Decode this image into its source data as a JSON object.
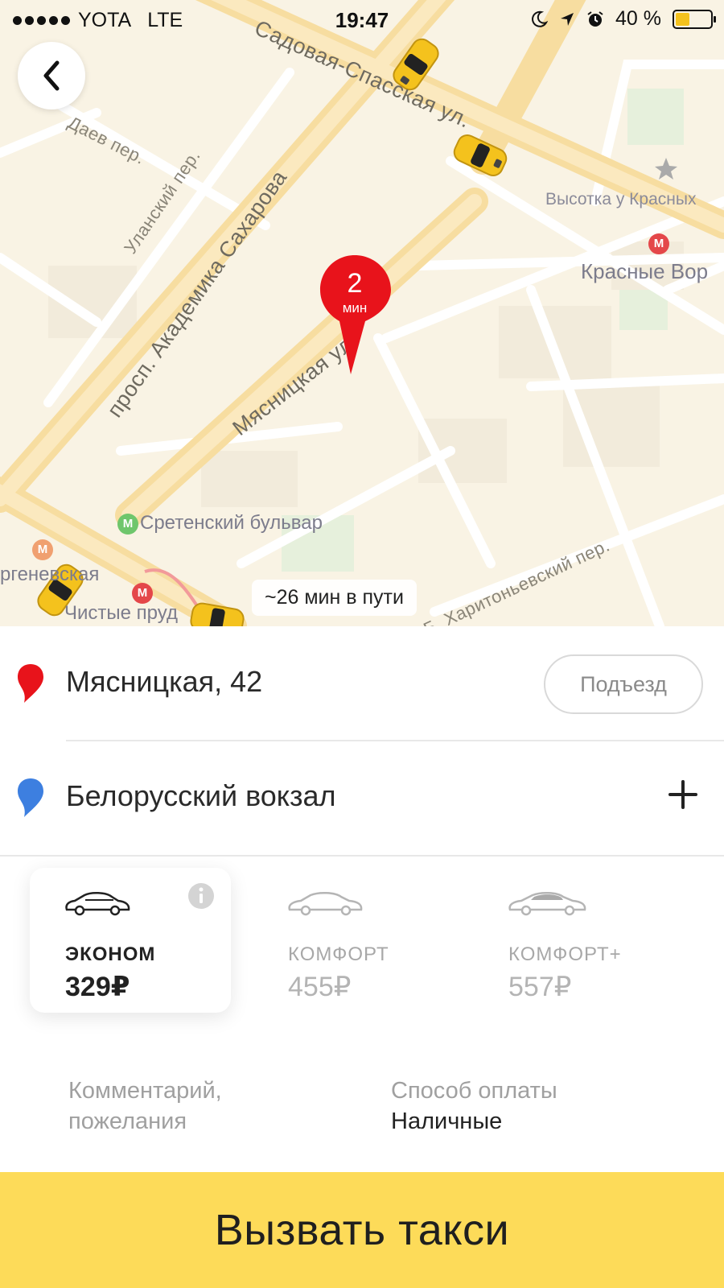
{
  "status_bar": {
    "carrier": "YOTA",
    "network": "LTE",
    "time": "19:47",
    "battery_percent": "40 %",
    "battery_level": 0.4,
    "icons": [
      "signal-dots-icon",
      "moon-icon",
      "location-arrow-icon",
      "alarm-icon",
      "battery-icon"
    ]
  },
  "map": {
    "streets": {
      "sadovaya": "Садовая-Спасская ул.",
      "daev": "Даев пер.",
      "ulansky": "Уланский пер.",
      "sakharova": "просп. Академика Сахарова",
      "myasnitskaya": "Мясницкая ул.",
      "kharitonyevsky": "Б. Харитоньевский пер."
    },
    "pois": {
      "vysotka": "Высотка у Красных",
      "krasnye_vorota": "Красные Вор",
      "sretensky": "Сретенский бульвар",
      "turgenevskaya": "ргеневская",
      "chistye_prudy": "Чистые пруд"
    },
    "metro_letter": "М",
    "pin": {
      "number": "2",
      "unit": "мин"
    },
    "trip_time": "~26 мин в пути",
    "colors": {
      "map_bg": "#f9f3e4",
      "pin": "#e8131b",
      "taxi": "#f4c21d"
    }
  },
  "route": {
    "from": "Мясницкая, 42",
    "entrance_label": "Подъезд",
    "to": "Белорусский вокзал",
    "colors": {
      "from_marker": "#e8131b",
      "to_marker": "#3d7fe0"
    }
  },
  "tariffs": [
    {
      "name": "ЭКОНОМ",
      "price": "329₽",
      "selected": true
    },
    {
      "name": "КОМФОРТ",
      "price": "455₽",
      "selected": false
    },
    {
      "name": "КОМФОРТ+",
      "price": "557₽",
      "selected": false
    }
  ],
  "options": {
    "comment_line1": "Комментарий,",
    "comment_line2": "пожелания",
    "payment_label": "Способ оплаты",
    "payment_value": "Наличные"
  },
  "call_button": {
    "label": "Вызвать такси",
    "color": "#fddb59"
  }
}
